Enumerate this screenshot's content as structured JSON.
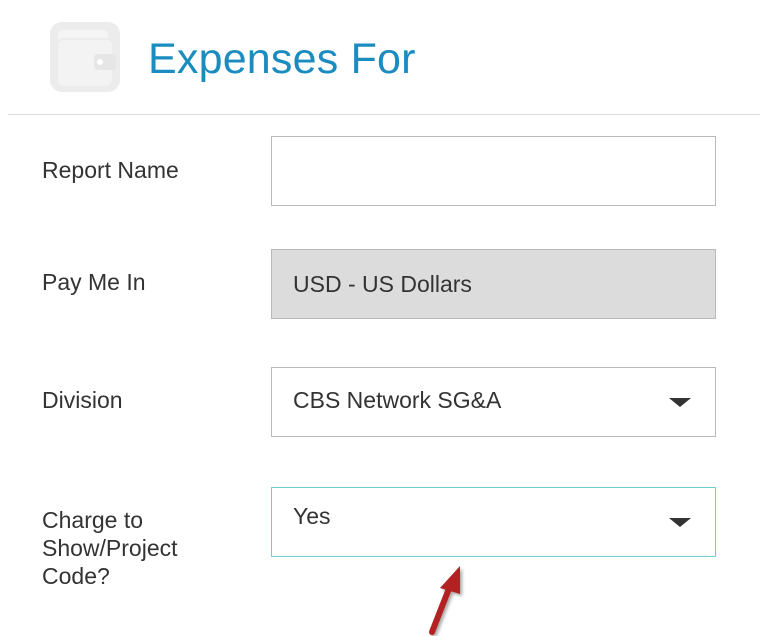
{
  "header": {
    "title": "Expenses For",
    "icon": "wallet-icon"
  },
  "form": {
    "report_name": {
      "label": "Report Name",
      "value": "",
      "placeholder": ""
    },
    "pay_me_in": {
      "label": "Pay Me In",
      "value": "USD - US Dollars"
    },
    "division": {
      "label": "Division",
      "value": "CBS Network SG&A"
    },
    "charge_to_show": {
      "label_lines": [
        "Charge to",
        "Show/Project",
        "Code?"
      ],
      "value": "Yes"
    }
  },
  "annotation": {
    "arrow_color": "#b22222"
  },
  "colors": {
    "title": "#1a8cbf",
    "focus_border": "#6fcfd0",
    "readonly_bg": "#dcdcdc"
  }
}
